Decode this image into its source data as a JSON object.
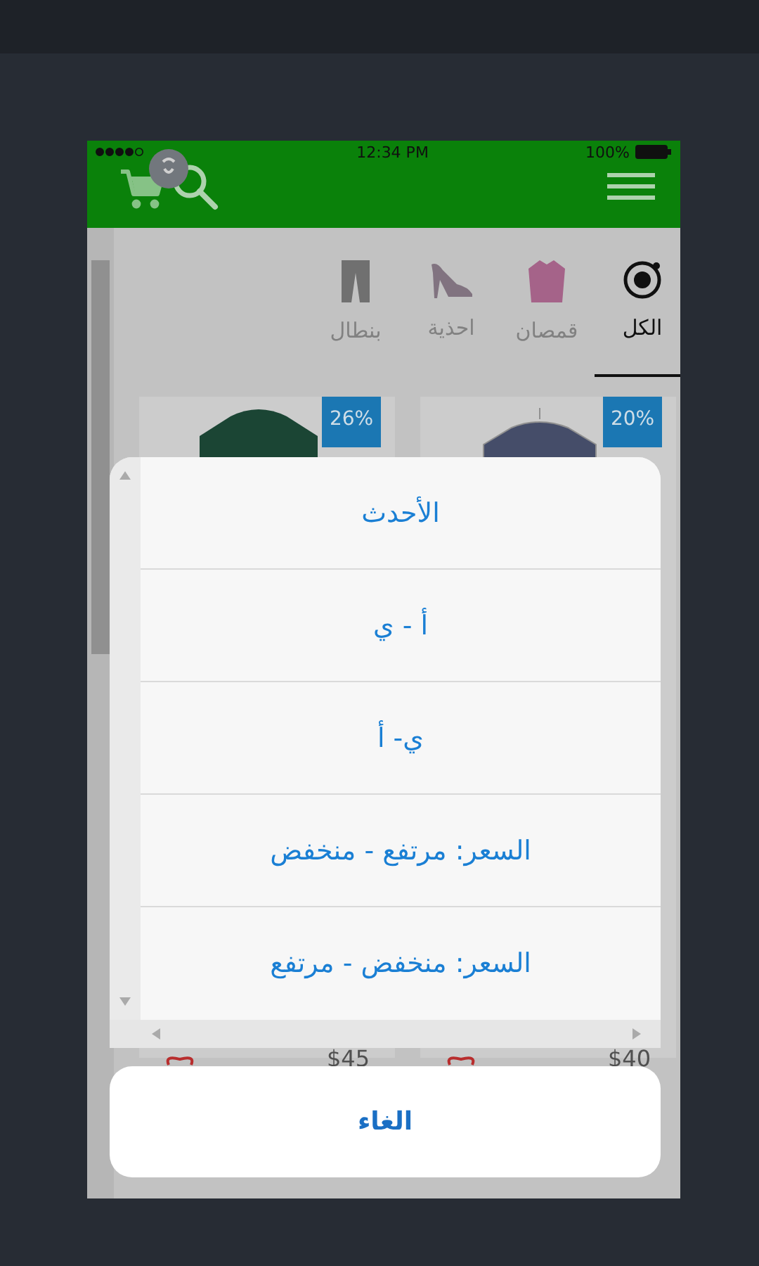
{
  "status_bar": {
    "time": "12:34 PM",
    "battery": "100%"
  },
  "tabs": [
    {
      "label": "الكل",
      "kind": "all",
      "selected": true
    },
    {
      "label": "قمصان",
      "kind": "shirt",
      "selected": false
    },
    {
      "label": "احذية",
      "kind": "shoe",
      "selected": false
    },
    {
      "label": "بنطال",
      "kind": "pants",
      "selected": false
    }
  ],
  "products": [
    {
      "badge": "20%",
      "price": "$40",
      "kind": "shirt"
    },
    {
      "badge": "26%",
      "price": "$45",
      "kind": "sweater"
    }
  ],
  "sort_sheet": {
    "options": [
      "الأحدث",
      "أ - ي",
      "ي- أ",
      "السعر: مرتفع - منخفض",
      "السعر: منخفض - مرتفع"
    ],
    "cancel": "الغاء"
  }
}
